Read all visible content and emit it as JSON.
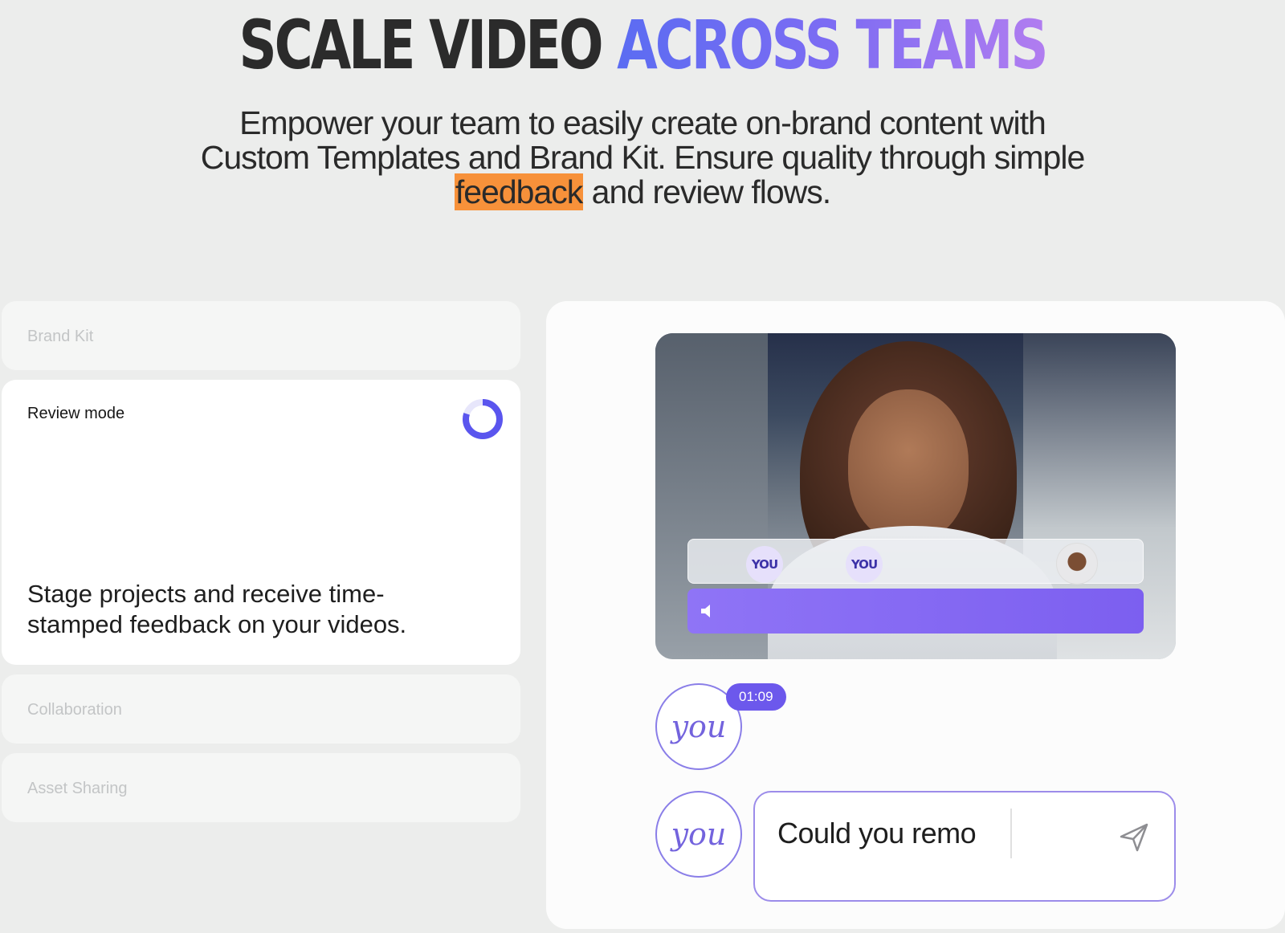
{
  "hero": {
    "title_dark": "SCALE VIDEO",
    "title_accent": "ACROSS TEAMS",
    "subtitle_line1": "Empower your team to easily create on-brand content with",
    "subtitle_line2": "Custom Templates and Brand Kit. Ensure quality through simple",
    "subtitle_highlight": "feedback",
    "subtitle_line3_end": " and review flows."
  },
  "features": {
    "items": [
      {
        "label": "Brand Kit"
      },
      {
        "label": "Review mode",
        "description": "Stage projects and receive time-stamped feedback on your videos.",
        "progress": 0.8
      },
      {
        "label": "Collaboration"
      },
      {
        "label": "Asset Sharing"
      }
    ]
  },
  "player": {
    "markers": [
      "YOU",
      "YOU"
    ],
    "timestamp": "01:09",
    "avatar_text": "you",
    "comment_draft": "Could you remo"
  },
  "colors": {
    "accent": "#6c58ec",
    "highlight": "#f7913a",
    "gradient_start": "#5b6cf2",
    "gradient_end": "#b17df0"
  },
  "icons": [
    "progress-ring-icon",
    "speaker-icon",
    "send-icon"
  ]
}
